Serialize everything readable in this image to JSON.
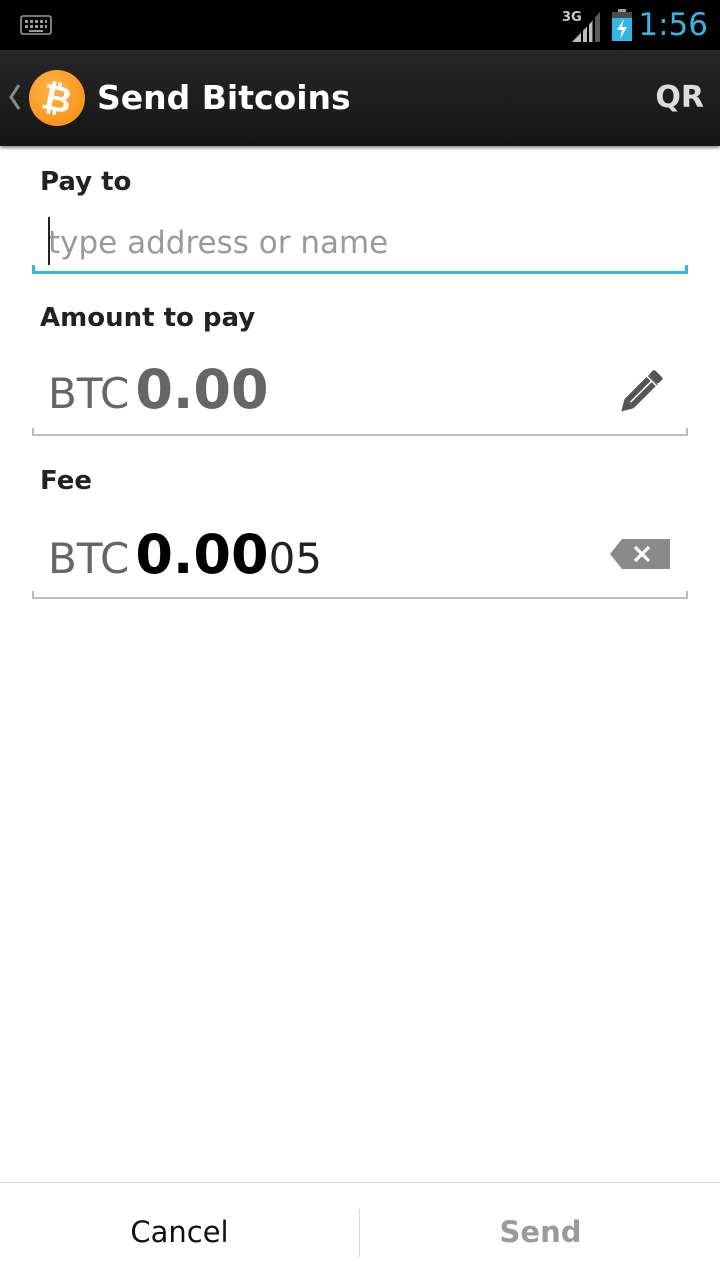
{
  "status_bar": {
    "network_label": "3G",
    "time": "1:56",
    "accent_color": "#33b5e5",
    "left_icon": "keyboard-icon",
    "right_icons": [
      "signal-3g-icon",
      "battery-charging-icon"
    ]
  },
  "action_bar": {
    "title": "Send Bitcoins",
    "logo_glyph": "₿",
    "logo_icon": "bitcoin-logo-icon",
    "up_icon": "up-caret-icon",
    "qr_label": "QR",
    "logo_color": "#f7931a"
  },
  "form": {
    "pay_to": {
      "label": "Pay to",
      "value": "",
      "placeholder": "type address or name"
    },
    "amount": {
      "label": "Amount to pay",
      "currency": "BTC",
      "value_main": "0.00",
      "value_extra": "",
      "icon": "pencil-edit-icon"
    },
    "fee": {
      "label": "Fee",
      "currency": "BTC",
      "value_main": "0.00",
      "value_extra": "05",
      "icon": "backspace-clear-icon"
    }
  },
  "buttons": {
    "cancel_label": "Cancel",
    "send_label": "Send"
  }
}
